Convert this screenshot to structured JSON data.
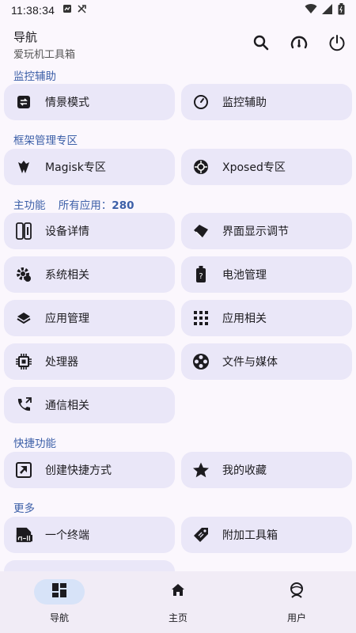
{
  "status": {
    "time": "11:38:34"
  },
  "header": {
    "title": "导航",
    "subtitle": "爱玩机工具箱"
  },
  "sections": {
    "monitor": {
      "title": "监控辅助"
    },
    "framework": {
      "title": "框架管理专区"
    },
    "functions": {
      "title": "主功能",
      "apps_label": "所有应用：",
      "apps_count": "280"
    },
    "shortcuts": {
      "title": "快捷功能"
    },
    "more": {
      "title": "更多"
    }
  },
  "items": {
    "scene_mode": "情景模式",
    "monitor_assist": "监控辅助",
    "magisk": "Magisk专区",
    "xposed": "Xposed专区",
    "device_details": "设备详情",
    "display_adjust": "界面显示调节",
    "system": "系统相关",
    "battery": "电池管理",
    "app_manage": "应用管理",
    "app_related": "应用相关",
    "processor": "处理器",
    "files_media": "文件与媒体",
    "comms": "通信相关",
    "create_shortcut": "创建快捷方式",
    "favorites": "我的收藏",
    "terminal": "一个终端",
    "extra_toolbox": "附加工具箱"
  },
  "nav": {
    "tabs": [
      {
        "label": "导航"
      },
      {
        "label": "主页"
      },
      {
        "label": "用户"
      }
    ]
  },
  "colors": {
    "accent": "#3c5fa8",
    "card": "#eae7f8",
    "nav_active": "#d7e3f8"
  }
}
